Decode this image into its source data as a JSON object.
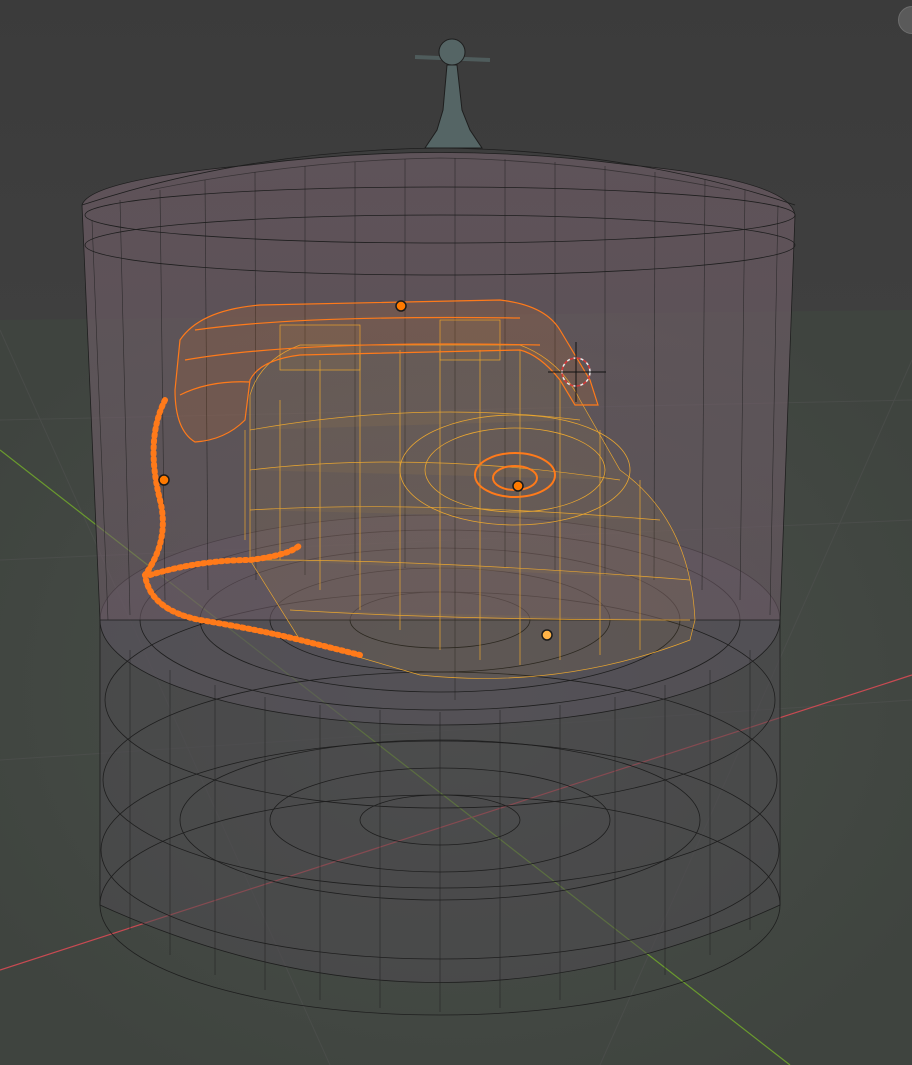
{
  "viewport": {
    "mode": "wireframe",
    "shading": "x-ray",
    "background_color": "#3d3d3d",
    "ground_color": "#454b45",
    "colors": {
      "unselected_wire": "#1e1e1e",
      "dome_fill": "#8a6f7c",
      "selected_wire": "#ff7a1a",
      "selected_active_wire": "#ffb347",
      "origin_point": "#ff7a00",
      "axis_x": "#c84a52",
      "axis_y": "#6a9a2e",
      "cursor": "#e8e8e8"
    },
    "objects": [
      {
        "name": "glass-dome",
        "selected": false
      },
      {
        "name": "base-cylinder",
        "selected": false
      },
      {
        "name": "telephone-body",
        "selected": true
      },
      {
        "name": "telephone-handset",
        "selected": true
      },
      {
        "name": "telephone-cord",
        "selected": true
      },
      {
        "name": "rotary-dial",
        "selected": true
      }
    ],
    "origin_points": 4,
    "icons": {
      "cursor": "3d-cursor-icon",
      "origin": "object-origin-icon"
    }
  }
}
